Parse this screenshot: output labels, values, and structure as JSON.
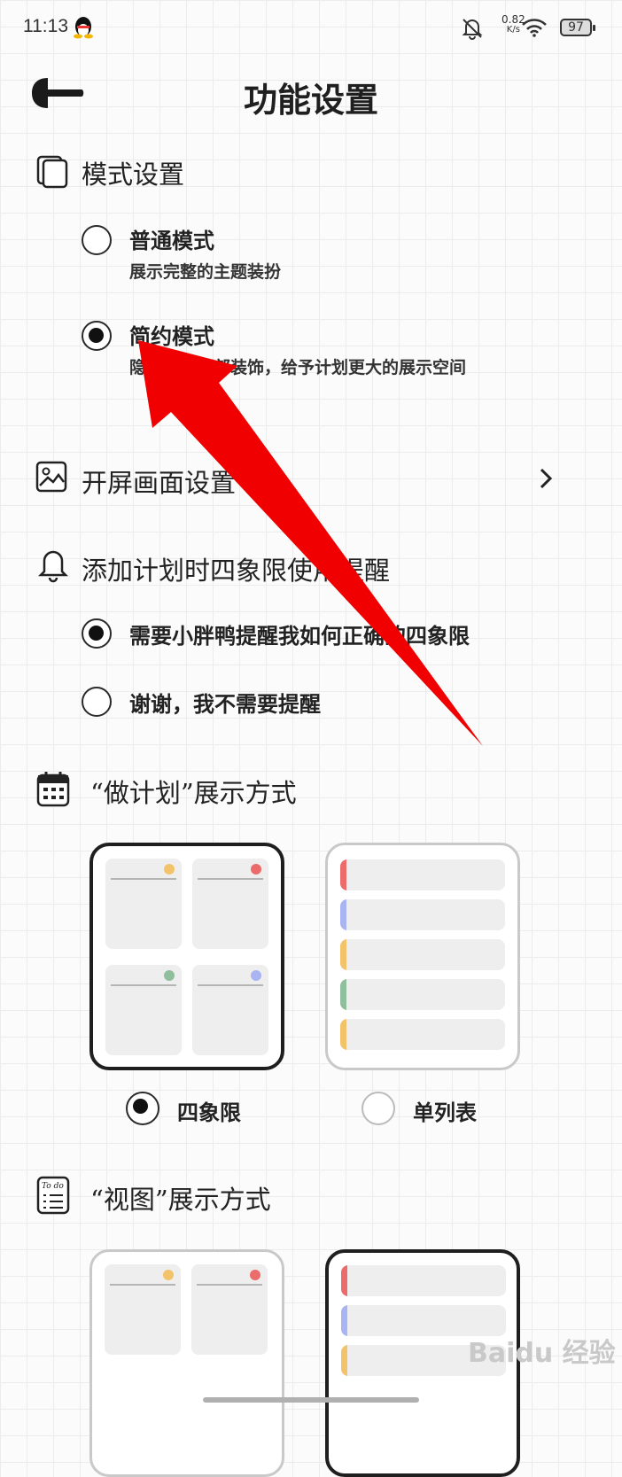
{
  "status_bar": {
    "time": "11:13",
    "net_speed_value": "0.82",
    "net_speed_unit": "K/s",
    "battery": "97"
  },
  "header": {
    "title": "功能设置"
  },
  "mode": {
    "title": "模式设置",
    "options": [
      {
        "title": "普通模式",
        "desc": "展示完整的主题装扮",
        "selected": false
      },
      {
        "title": "简约模式",
        "desc": "隐藏主题顶部装饰，给予计划更大的展示空间",
        "selected": true
      }
    ]
  },
  "splash": {
    "title": "开屏画面设置"
  },
  "reminder": {
    "title": "添加计划时四象限使用提醒",
    "options": [
      {
        "label": "需要小胖鸭提醒我如何正确的四象限",
        "selected": true
      },
      {
        "label": "谢谢，我不需要提醒",
        "selected": false
      }
    ]
  },
  "plan_display": {
    "title": "“做计划”展示方式",
    "options": [
      {
        "label": "四象限",
        "selected": true
      },
      {
        "label": "单列表",
        "selected": false
      }
    ]
  },
  "view_display": {
    "title": "“视图”展示方式"
  },
  "watermark": "Baidu 经验",
  "icons": [
    "qq-penguin-icon",
    "bell-off-icon",
    "wifi-icon",
    "battery-icon",
    "back-arrow-icon",
    "cards-icon",
    "image-icon",
    "chevron-right-icon",
    "bell-icon",
    "calendar-icon",
    "todo-icon"
  ],
  "colors": {
    "accent_red": "#f00000",
    "dot_yellow": "#f3c36a",
    "dot_red": "#ec6b6b",
    "dot_green": "#8fbf9c",
    "dot_blue": "#a9b4f2"
  }
}
